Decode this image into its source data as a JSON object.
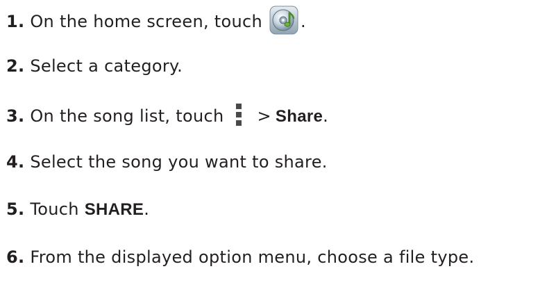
{
  "steps": [
    {
      "number": "1.",
      "text": "On the home screen, touch",
      "icon": "music-app-icon",
      "after": "."
    },
    {
      "number": "2.",
      "text": "Select a category."
    },
    {
      "number": "3.",
      "text": "On the song list, touch",
      "icon": "overflow-menu-icon",
      "sep": ">",
      "bold": "Share",
      "after": "."
    },
    {
      "number": "4.",
      "text": "Select the song you want to share."
    },
    {
      "number": "5.",
      "text": "Touch",
      "bold": "SHARE",
      "after": "."
    },
    {
      "number": "6.",
      "text": "From the displayed option menu, choose a file type."
    }
  ]
}
